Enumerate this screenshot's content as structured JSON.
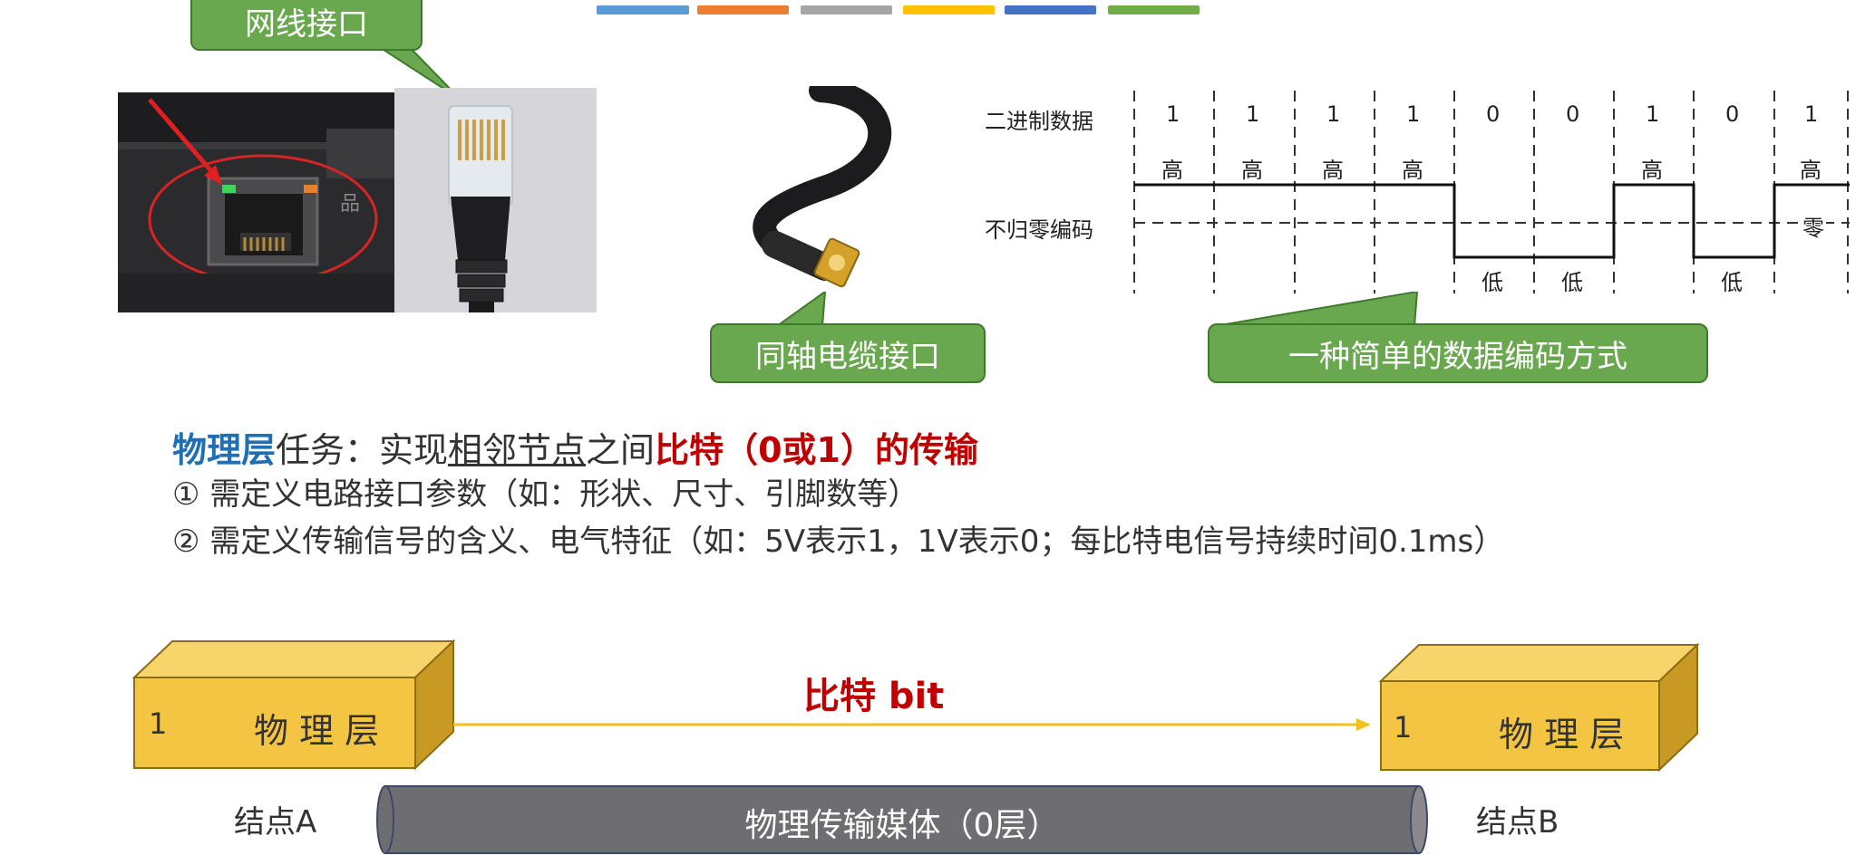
{
  "top_bars": [
    "#5b9bd5",
    "#ed7d31",
    "#a5a5a5",
    "#ffc000",
    "#4472c4",
    "#70ad47"
  ],
  "callouts": {
    "ethernet_port": "网线接口",
    "coax_port": "同轴电缆接口",
    "encoding": "一种简单的数据编码方式"
  },
  "nrz": {
    "row_binary_label": "二进制数据",
    "row_encoding_label": "不归零编码",
    "bits": [
      "1",
      "1",
      "1",
      "1",
      "0",
      "0",
      "1",
      "0",
      "1"
    ],
    "high_label": "高",
    "low_label": "低",
    "zero_label": "零"
  },
  "text": {
    "line1": {
      "part1": "物理层",
      "part2": "任务：实现",
      "part3": "相邻节点",
      "part4": "之间",
      "part5": "比特（0或1）的传输"
    },
    "line2": "①  需定义电路接口参数（如：形状、尺寸、引脚数等）",
    "line3": "②  需定义传输信号的含义、电气特征（如：5V表示1，1V表示0；每比特电信号持续时间0.1ms）"
  },
  "diagram": {
    "left_box": {
      "number": "1",
      "label": "物 理 层"
    },
    "right_box": {
      "number": "1",
      "label": "物 理 层"
    },
    "bit_label": "比特 bit",
    "node_a": "结点A",
    "node_b": "结点B",
    "medium": "物理传输媒体（0层）"
  },
  "colors": {
    "callout_green": "#6aa84f",
    "accent_blue": "#1f6fb5",
    "accent_red": "#c00000",
    "box_yellow": "#f4c542",
    "arrow_yellow": "#f2c31c",
    "medium_gray": "#6e6e72"
  }
}
